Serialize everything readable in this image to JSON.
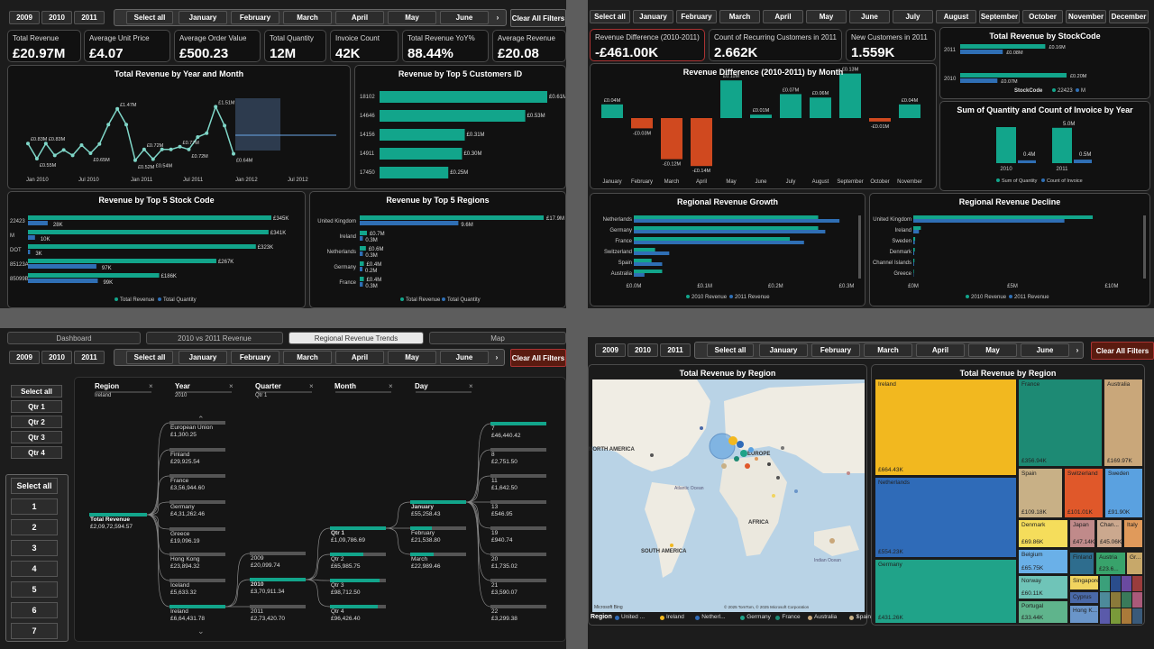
{
  "q1": {
    "years": [
      "2009",
      "2010",
      "2011"
    ],
    "months": [
      "Select all",
      "January",
      "February",
      "March",
      "April",
      "May",
      "June"
    ],
    "clear": "Clear All Filters",
    "kpis": [
      {
        "label": "Total Revenue",
        "value": "£20.97M"
      },
      {
        "label": "Average Unit Price",
        "value": "£4.07"
      },
      {
        "label": "Average Order Value",
        "value": "£500.23"
      },
      {
        "label": "Total Quantity",
        "value": "12M"
      },
      {
        "label": "Invoice Count",
        "value": "42K"
      },
      {
        "label": "Total Revenue YoY%",
        "value": "88.44%"
      },
      {
        "label": "Average Revenue",
        "value": "£20.08"
      }
    ],
    "trend": {
      "title": "Total Revenue by Year and Month",
      "ticks": [
        "Jan 2010",
        "Jul 2010",
        "Jan 2011",
        "Jul 2011",
        "Jan 2012",
        "Jul 2012"
      ],
      "values": [
        0.83,
        0.55,
        0.83,
        0.61,
        0.71,
        0.61,
        0.8,
        0.65,
        0.82,
        1.18,
        1.47,
        1.18,
        0.52,
        0.72,
        0.54,
        0.72,
        0.72,
        0.77,
        0.72,
        0.95,
        1.02,
        1.51,
        1.16,
        0.64
      ],
      "labels": [
        "£0.83M",
        "£0.55M",
        "£0.83M",
        "£0.65M",
        "£1.47M",
        "£0.52M",
        "£0.72M",
        "£0.54M",
        "£0.77M",
        "£0.72M",
        "£1.51M",
        "£0.64M"
      ]
    },
    "customers": {
      "title": "Revenue by Top 5 Customers ID",
      "ids": [
        "18102",
        "14646",
        "14156",
        "14911",
        "17450"
      ],
      "values": [
        0.61,
        0.53,
        0.31,
        0.3,
        0.25
      ],
      "labels": [
        "£0.61M",
        "£0.53M",
        "£0.31M",
        "£0.30M",
        "£0.25M"
      ]
    },
    "stock": {
      "title": "Revenue by Top 5 Stock Code",
      "codes": [
        "22423",
        "M",
        "DOT",
        "85123A",
        "85099B"
      ],
      "revenue": [
        345,
        341,
        323,
        267,
        186
      ],
      "quantity": [
        28,
        10,
        3,
        97,
        99
      ],
      "rev_labels": [
        "£345K",
        "£341K",
        "£323K",
        "£267K",
        "£186K"
      ],
      "qty_labels": [
        "28K",
        "10K",
        "3K",
        "97K",
        "99K"
      ],
      "legend": [
        "Total Revenue",
        "Total Quantity"
      ]
    },
    "regions": {
      "title": "Revenue by Top 5 Regions",
      "names": [
        "United Kingdom",
        "Ireland",
        "Netherlands",
        "Germany",
        "France"
      ],
      "revenue": [
        17.9,
        0.7,
        0.6,
        0.4,
        0.4
      ],
      "quantity": [
        9.6,
        0.3,
        0.3,
        0.2,
        0.3
      ],
      "rev_labels": [
        "£17.9M",
        "£0.7M",
        "£0.6M",
        "£0.4M",
        "£0.4M"
      ],
      "qty_labels": [
        "9.6M",
        "0.3M",
        "0.3M",
        "0.2M",
        "0.3M"
      ],
      "legend": [
        "Total Revenue",
        "Total Quantity"
      ]
    }
  },
  "q2": {
    "months": [
      "Select all",
      "January",
      "February",
      "March",
      "April",
      "May",
      "June",
      "July",
      "August",
      "September",
      "October",
      "November",
      "December"
    ],
    "kpis": [
      {
        "label": "Revenue Difference (2010-2011)",
        "value": "-£461.00K"
      },
      {
        "label": "Count of Recurring Customers in 2011",
        "value": "2.662K"
      },
      {
        "label": "New Customers in 2011",
        "value": "1.559K"
      }
    ],
    "stockcode": {
      "title": "Total Revenue by StockCode",
      "years": [
        "2011",
        "2010"
      ],
      "bars": [
        {
          "a": 0.16,
          "b": 0.08
        },
        {
          "a": 0.2,
          "b": 0.07
        }
      ],
      "labels": [
        "£0.16M",
        "£0.08M",
        "£0.20M",
        "£0.07M"
      ],
      "legend": [
        "StockCode",
        "22423",
        "M"
      ]
    },
    "sumqty": {
      "title": "Sum of Quantity and Count of Invoice by Year",
      "years": [
        "2010",
        "2011"
      ],
      "qty": [
        5.1,
        5.0
      ],
      "inv": [
        0.4,
        0.5
      ],
      "labels": [
        "5.0M",
        "0.4M",
        "0.5M"
      ],
      "legend": [
        "Sum of Quantity",
        "Count of Invoice"
      ]
    },
    "diff": {
      "title": "Revenue Difference (2010-2011) by Month",
      "months": [
        "January",
        "February",
        "March",
        "April",
        "May",
        "June",
        "July",
        "August",
        "September",
        "October",
        "November"
      ],
      "values": [
        0.04,
        -0.03,
        -0.12,
        -0.14,
        0.11,
        0.01,
        0.07,
        0.06,
        0.13,
        -0.01,
        0.04
      ],
      "labels": [
        "£0.04M",
        "-£0.03M",
        "-£0.12M",
        "-£0.14M",
        "£0.11M",
        "£0.01M",
        "£0.07M",
        "£0.06M",
        "£0.13M",
        "-£0.01M",
        "£0.04M"
      ]
    },
    "growth": {
      "title": "Regional Revenue Growth",
      "regions": [
        "Netherlands",
        "Germany",
        "France",
        "Switzerland",
        "Spain",
        "Australia"
      ],
      "r2010": [
        2.6,
        2.6,
        2.2,
        0.3,
        0.25,
        0.4
      ],
      "r2011": [
        2.9,
        2.7,
        2.4,
        0.5,
        0.4,
        0.15
      ],
      "ticks": [
        "£0.0M",
        "£0.1M",
        "£0.2M",
        "£0.3M"
      ],
      "legend": [
        "2010 Revenue",
        "2011 Revenue"
      ]
    },
    "decline": {
      "title": "Regional Revenue Decline",
      "regions": [
        "United Kingdom",
        "Ireland",
        "Sweden",
        "Denmark",
        "Channel Islands",
        "Greece"
      ],
      "r2010": [
        9.5,
        0.4,
        0.1,
        0.08,
        0.06,
        0.03
      ],
      "r2011": [
        8.0,
        0.3,
        0.08,
        0.05,
        0.04,
        0.02
      ],
      "ticks": [
        "£0M",
        "£5M",
        "£10M"
      ],
      "legend": [
        "2010 Revenue",
        "2011 Revenue"
      ]
    }
  },
  "q3": {
    "tabs": [
      "Dashboard",
      "2010 vs 2011 Revenue",
      "Regional Revenue Trends",
      "Map"
    ],
    "qtrs": [
      "Select all",
      "Qtr 1",
      "Qtr 2",
      "Qtr 3",
      "Qtr 4"
    ],
    "days": [
      "Select all",
      "1",
      "2",
      "3",
      "4",
      "5",
      "6",
      "7"
    ],
    "cols": [
      {
        "label": "Region",
        "sub": "Ireland"
      },
      {
        "label": "Year",
        "sub": "2010"
      },
      {
        "label": "Quarter",
        "sub": "Qtr 1"
      },
      {
        "label": "Month",
        "sub": ""
      },
      {
        "label": "Day",
        "sub": ""
      }
    ],
    "root": {
      "name": "Total Revenue",
      "value": "£2,09,72,594.57"
    },
    "regions": [
      {
        "n": "European Union",
        "v": "£1,300.25"
      },
      {
        "n": "Finland",
        "v": "£29,925.54"
      },
      {
        "n": "France",
        "v": "£3,56,944.60"
      },
      {
        "n": "Germany",
        "v": "£4,31,262.46"
      },
      {
        "n": "Greece",
        "v": "£19,096.19"
      },
      {
        "n": "Hong Kong",
        "v": "£23,894.32"
      },
      {
        "n": "Iceland",
        "v": "£5,633.32"
      },
      {
        "n": "Ireland",
        "v": "£6,64,431.78"
      }
    ],
    "years": [
      {
        "n": "2009",
        "v": "£20,099.74"
      },
      {
        "n": "2010",
        "v": "£3,70,911.34"
      },
      {
        "n": "2011",
        "v": "£2,73,420.70"
      }
    ],
    "quarters": [
      {
        "n": "Qtr 1",
        "v": "£1,09,786.69"
      },
      {
        "n": "Qtr 2",
        "v": "£65,985.75"
      },
      {
        "n": "Qtr 3",
        "v": "£98,712.50"
      },
      {
        "n": "Qtr 4",
        "v": "£96,426.40"
      }
    ],
    "monthsn": [
      {
        "n": "January",
        "v": "£55,258.43"
      },
      {
        "n": "February",
        "v": "£21,538.80"
      },
      {
        "n": "March",
        "v": "£22,989.46"
      }
    ],
    "dayn": [
      {
        "n": "7",
        "v": "£46,440.42"
      },
      {
        "n": "8",
        "v": "£2,751.50"
      },
      {
        "n": "11",
        "v": "£1,642.50"
      },
      {
        "n": "13",
        "v": "£546.95"
      },
      {
        "n": "19",
        "v": "£940.74"
      },
      {
        "n": "20",
        "v": "£1,735.02"
      },
      {
        "n": "21",
        "v": "£3,590.07"
      },
      {
        "n": "22",
        "v": "£3,299.38"
      }
    ]
  },
  "q4": {
    "map": {
      "title": "Total Revenue by Region",
      "labels": [
        "NORTH AMERICA",
        "EUROPE",
        "AFRICA",
        "SOUTH AMERICA",
        "Atlantic Ocean",
        "Indian Ocean"
      ],
      "credit": "© 2025 TomTom, © 2025 Microsoft Corporation",
      "legend_title": "Region",
      "legend": [
        "United ...",
        "Ireland",
        "Netherl...",
        "Germany",
        "France",
        "Australia",
        "Spain",
        "Switzerl..."
      ]
    },
    "tree": {
      "title": "Total Revenue by Region",
      "cells": [
        {
          "n": "Ireland",
          "v": "£664.43K",
          "c": "#f2b81f"
        },
        {
          "n": "France",
          "v": "£356.94K",
          "c": "#1d8a74"
        },
        {
          "n": "Australia",
          "v": "£169.97K",
          "c": "#c9a77a"
        },
        {
          "n": "Netherlands",
          "v": "£554.23K",
          "c": "#2f6bb8"
        },
        {
          "n": "Spain",
          "v": "£109.18K",
          "c": "#c8b086"
        },
        {
          "n": "Switzerland",
          "v": "£101.01K",
          "c": "#e0582a"
        },
        {
          "n": "Sweden",
          "v": "£91.90K",
          "c": "#5aa1e0"
        },
        {
          "n": "Denmark",
          "v": "£69.86K",
          "c": "#f5dd5b"
        },
        {
          "n": "Japan",
          "v": "£47.14K",
          "c": "#c08a8a"
        },
        {
          "n": "Chan...",
          "v": "£45.06K",
          "c": "#cba88e"
        },
        {
          "n": "Italy",
          "v": "",
          "c": "#e09a5b"
        },
        {
          "n": "Belgium",
          "v": "£65.75K",
          "c": "#6ab0e8"
        },
        {
          "n": "Finland",
          "v": "",
          "c": "#2e6d8e"
        },
        {
          "n": "Austria",
          "v": "£23.6...",
          "c": "#38a36b"
        },
        {
          "n": "Gr...",
          "v": "",
          "c": "#c7a86a"
        },
        {
          "n": "Germany",
          "v": "£431.26K",
          "c": "#20a389"
        },
        {
          "n": "Norway",
          "v": "£60.11K",
          "c": "#6fc4b8"
        },
        {
          "n": "Singapore",
          "v": "",
          "c": "#f1d45f"
        },
        {
          "n": "Cyprus",
          "v": "",
          "c": "#4a69a8"
        },
        {
          "n": "Portugal",
          "v": "£33.44K",
          "c": "#5fb48c"
        },
        {
          "n": "Hong K...",
          "v": "",
          "c": "#6a95c9"
        }
      ]
    }
  },
  "colors": {
    "teal": "#12a58b",
    "blue": "#2f6fb5",
    "red": "#d0491f",
    "bg": "#1c1c1c"
  }
}
